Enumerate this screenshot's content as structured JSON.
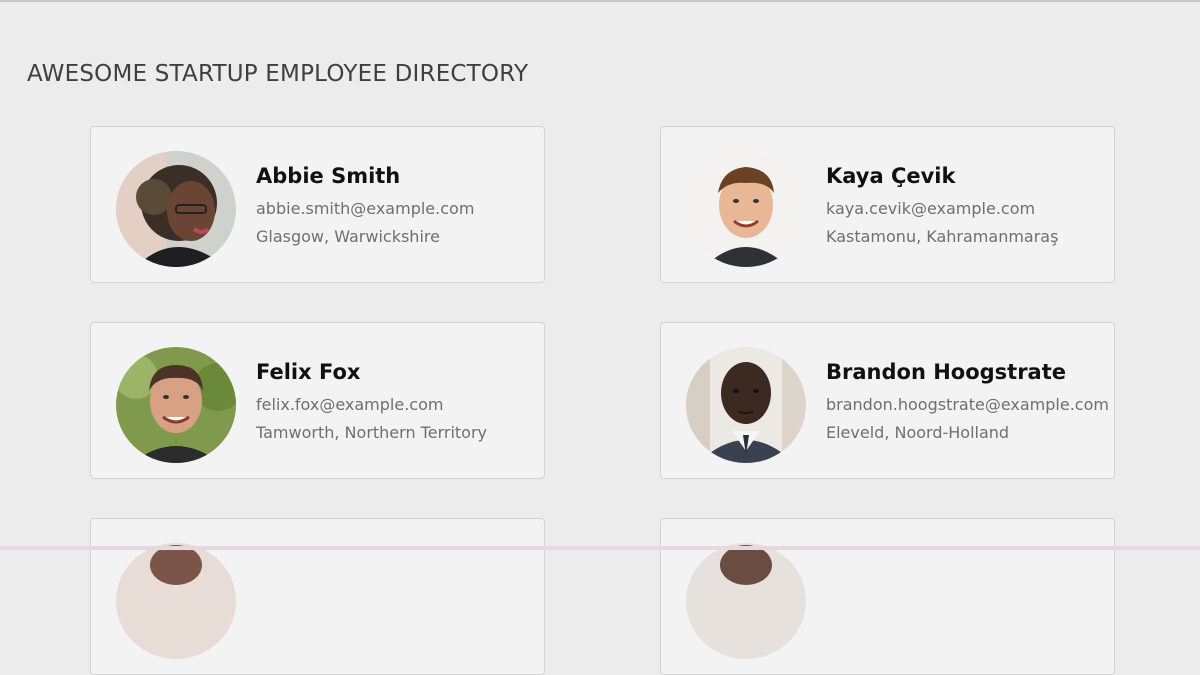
{
  "directory": {
    "title": "AWESOME STARTUP EMPLOYEE DIRECTORY",
    "employees": [
      {
        "name": "Abbie Smith",
        "email": "abbie.smith@example.com",
        "location": "Glasgow, Warwickshire"
      },
      {
        "name": "Kaya Çevik",
        "email": "kaya.cevik@example.com",
        "location": "Kastamonu, Kahramanmaraş"
      },
      {
        "name": "Felix Fox",
        "email": "felix.fox@example.com",
        "location": "Tamworth, Northern Territory"
      },
      {
        "name": "Brandon Hoogstrate",
        "email": "brandon.hoogstrate@example.com",
        "location": "Eleveld, Noord-Holland"
      }
    ]
  }
}
